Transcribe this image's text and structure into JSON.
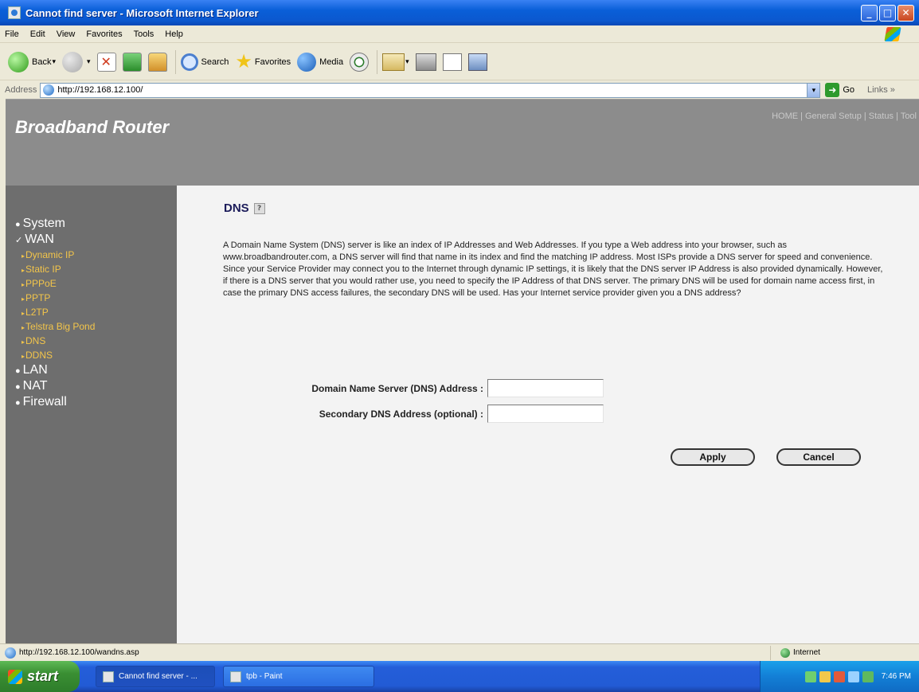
{
  "window": {
    "title": "Cannot find server - Microsoft Internet Explorer",
    "buttons": {
      "minimize": "_",
      "maximize": "□",
      "close": "✕"
    }
  },
  "menu": [
    "File",
    "Edit",
    "View",
    "Favorites",
    "Tools",
    "Help"
  ],
  "toolbar": {
    "back_label": "Back",
    "search_label": "Search",
    "favorites_label": "Favorites",
    "media_label": "Media"
  },
  "address": {
    "label": "Address",
    "url": "http://192.168.12.100/",
    "go_label": "Go",
    "links_label": "Links »"
  },
  "page": {
    "brand": "Broadband Router",
    "topnav": [
      "HOME",
      "General Setup",
      "Status",
      "Tool"
    ],
    "sidebar": {
      "main": [
        "System",
        "WAN",
        "LAN",
        "NAT",
        "Firewall"
      ],
      "wan_sub": [
        "Dynamic IP",
        "Static IP",
        "PPPoE",
        "PPTP",
        "L2TP",
        "Telstra Big Pond",
        "DNS",
        "DDNS"
      ]
    },
    "title": "DNS",
    "description": "A Domain Name System (DNS) server is like an index of IP Addresses and Web Addresses. If you type a Web address into your browser, such as www.broadbandrouter.com, a DNS server will find that name in its index and find the matching IP address. Most ISPs provide a DNS server for speed and convenience. Since your Service Provider may connect you to the Internet through dynamic IP settings, it is likely that the DNS server IP Address is also provided dynamically. However, if there is a DNS server that you would rather use, you need to specify the IP Address of that DNS server. The primary DNS will be used for domain name access first, in case the primary DNS access failures, the secondary DNS will be used. Has your Internet service provider given you a DNS address?",
    "form": {
      "primary_label": "Domain Name Server (DNS) Address :",
      "primary_value": "",
      "secondary_label": "Secondary DNS Address (optional) :",
      "secondary_value": ""
    },
    "apply_label": "Apply",
    "cancel_label": "Cancel"
  },
  "status": {
    "text": "http://192.168.12.100/wandns.asp",
    "zone": "Internet"
  },
  "taskbar": {
    "start": "start",
    "tasks": [
      "Cannot find server - ...",
      "tpb - Paint"
    ],
    "clock": "7:46 PM"
  }
}
